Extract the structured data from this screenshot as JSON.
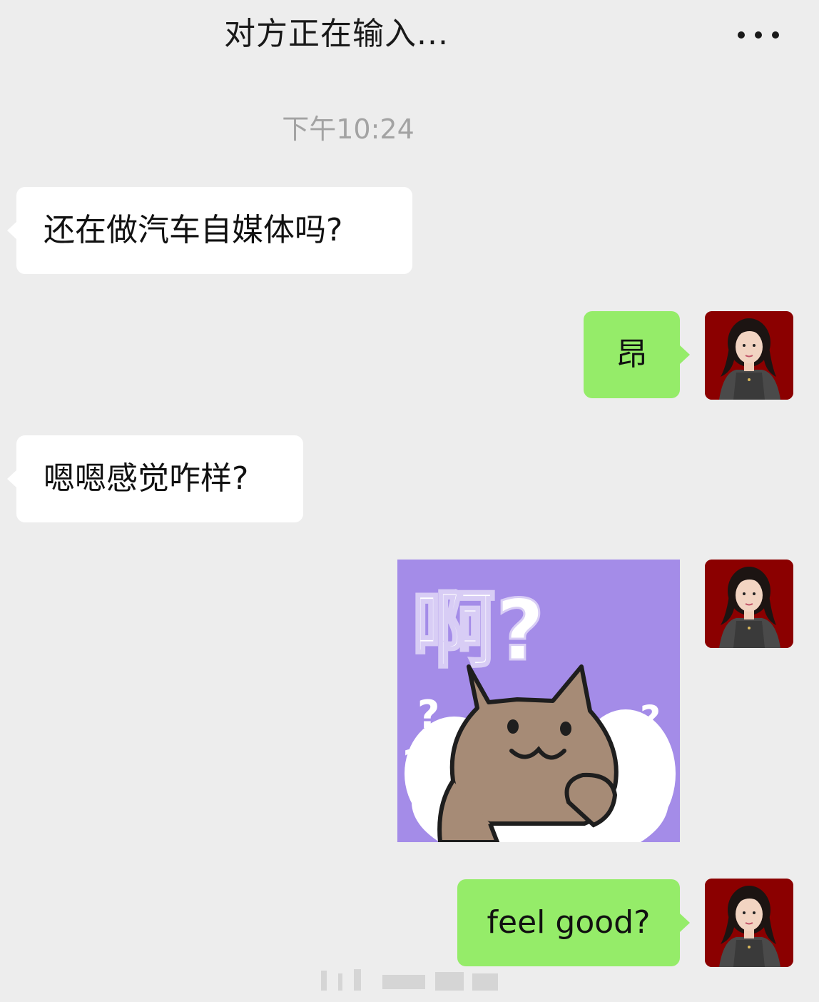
{
  "header": {
    "title": "对方正在输入...",
    "more_icon": "more-dots-icon"
  },
  "timestamp": "下午10:24",
  "messages": [
    {
      "side": "left",
      "type": "text",
      "text": "还在做汽车自媒体吗?"
    },
    {
      "side": "right",
      "type": "text",
      "text": "昂"
    },
    {
      "side": "left",
      "type": "text",
      "text": "嗯嗯感觉咋样?"
    },
    {
      "side": "right",
      "type": "sticker",
      "sticker_text": "啊?"
    },
    {
      "side": "right",
      "type": "text",
      "text": "feel good?"
    }
  ],
  "colors": {
    "background": "#ededed",
    "incoming_bubble": "#ffffff",
    "outgoing_bubble": "#95ec69",
    "timestamp": "#a3a3a3",
    "avatar_bg": "#8b0000",
    "sticker_bg": "#a48ce8",
    "cat": "#a68b76"
  }
}
